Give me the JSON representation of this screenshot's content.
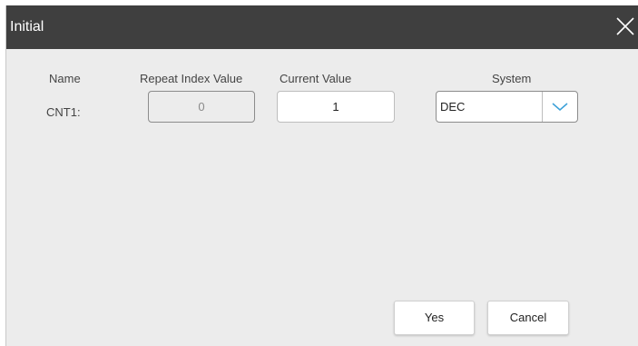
{
  "window": {
    "title": "Initial",
    "close_icon": "close-icon"
  },
  "table": {
    "headers": {
      "name": "Name",
      "repeat_index_value": "Repeat Index Value",
      "current_value": "Current Value",
      "system": "System"
    },
    "rows": [
      {
        "name": "CNT1:",
        "repeat_index_value": "0",
        "current_value": "1",
        "system": "DEC"
      }
    ]
  },
  "dropdown": {
    "icon": "chevron-down-icon",
    "accent_color": "#3aa0d8"
  },
  "buttons": {
    "yes_label": "Yes",
    "cancel_label": "Cancel"
  }
}
